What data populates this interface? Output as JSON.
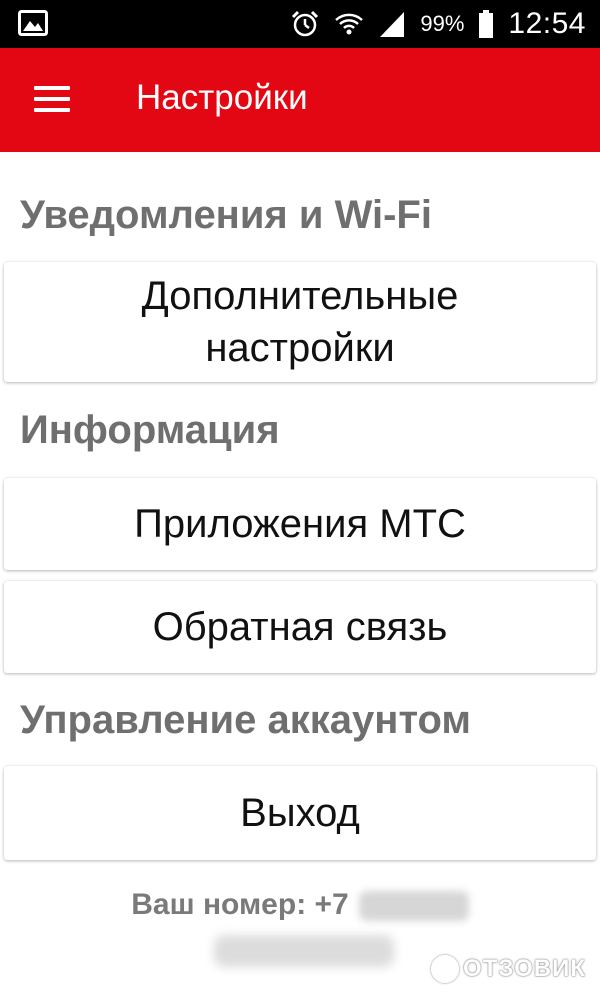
{
  "status_bar": {
    "notification_icon": "image-icon",
    "icons": [
      "alarm-icon",
      "wifi-icon",
      "signal-icon",
      "battery-icon"
    ],
    "battery_percent": "99%",
    "time": "12:54"
  },
  "toolbar": {
    "menu_icon": "hamburger-menu-icon",
    "title": "Настройки",
    "color": "#e30613"
  },
  "sections": [
    {
      "header": "Уведомления и Wi-Fi",
      "items": [
        {
          "line1": "Дополнительные",
          "line2": "настройки"
        }
      ]
    },
    {
      "header": "Информация",
      "items": [
        {
          "label": "Приложения МТС"
        },
        {
          "label": "Обратная связь"
        }
      ]
    },
    {
      "header": "Управление аккаунтом",
      "items": [
        {
          "label": "Выход"
        }
      ]
    }
  ],
  "footer": {
    "number_label": "Ваш номер: +7"
  },
  "watermark": {
    "text": "ОТЗОВИК"
  }
}
